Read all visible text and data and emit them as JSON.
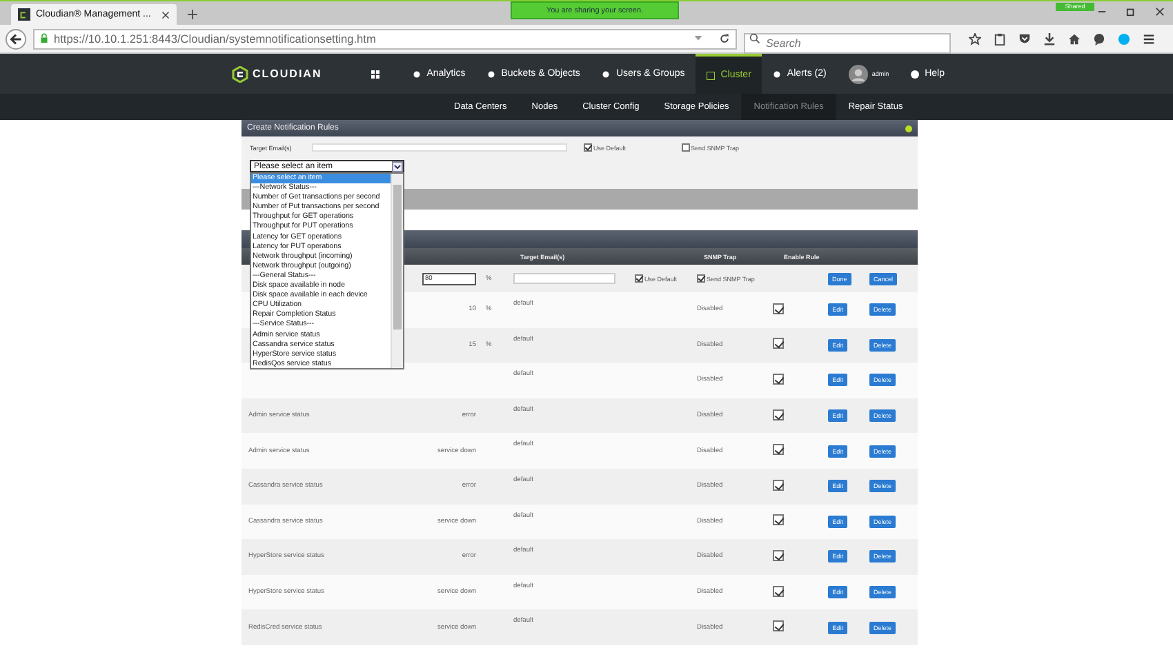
{
  "browser": {
    "tab_title": "Cloudian® Management ...",
    "url": "https://10.10.1.251:8443/Cloudian/systemnotificationsetting.htm",
    "search_placeholder": "Search",
    "sharing_banner": "You are sharing your screen.",
    "shared_badge": "Shared"
  },
  "nav": {
    "logo": "CLOUDIAN",
    "items": [
      {
        "label": "Analytics",
        "selected": false
      },
      {
        "label": "Buckets & Objects",
        "selected": false
      },
      {
        "label": "Users & Groups",
        "selected": false
      },
      {
        "label": "Cluster",
        "selected": true
      },
      {
        "label": "Alerts (2)",
        "selected": false
      }
    ],
    "user": "admin",
    "help": "Help"
  },
  "subnav": [
    {
      "label": "Data Centers",
      "selected": false
    },
    {
      "label": "Nodes",
      "selected": false
    },
    {
      "label": "Cluster Config",
      "selected": false
    },
    {
      "label": "Storage Policies",
      "selected": false
    },
    {
      "label": "Notification Rules",
      "selected": true
    },
    {
      "label": "Repair Status",
      "selected": false
    }
  ],
  "create_panel": {
    "title": "Create Notification Rules",
    "target_label": "Target Email(s)",
    "use_default": {
      "label": "Use Default",
      "checked": true
    },
    "send_snmp": {
      "label": "Send SNMP Trap",
      "checked": false
    },
    "select_value": "Please select an item",
    "options": [
      {
        "label": "Please select an item",
        "selected": true
      },
      {
        "label": "---Network Status---",
        "selected": false
      },
      {
        "label": "Number of Get transactions per second",
        "selected": false
      },
      {
        "label": "Number of Put transactions per second",
        "selected": false
      },
      {
        "label": "Throughput for GET operations",
        "selected": false
      },
      {
        "label": "Throughput for PUT operations",
        "selected": false
      },
      {
        "label": "Latency for GET operations",
        "selected": false
      },
      {
        "label": "Latency for PUT operations",
        "selected": false
      },
      {
        "label": "Network throughput (incoming)",
        "selected": false
      },
      {
        "label": "Network throughput (outgoing)",
        "selected": false
      },
      {
        "label": "---General Status---",
        "selected": false
      },
      {
        "label": "Disk space available in node",
        "selected": false
      },
      {
        "label": "Disk space available in each device",
        "selected": false
      },
      {
        "label": "CPU Utilization",
        "selected": false
      },
      {
        "label": "Repair Completion Status",
        "selected": false
      },
      {
        "label": "---Service Status---",
        "selected": false
      },
      {
        "label": "Admin service status",
        "selected": false
      },
      {
        "label": "Cassandra service status",
        "selected": false
      },
      {
        "label": "HyperStore service status",
        "selected": false
      },
      {
        "label": "RedisQos service status",
        "selected": false
      }
    ]
  },
  "rules_table": {
    "columns": [
      "Target Email(s)",
      "SNMP Trap",
      "Enable Rule"
    ],
    "rows": [
      {
        "kind": "edit",
        "value": "80",
        "unit": "%",
        "use_default": {
          "label": "Use Default",
          "checked": true
        },
        "send_snmp": {
          "label": "Send SNMP Trap",
          "checked": true
        },
        "buttons": [
          "Done",
          "Cancel"
        ]
      },
      {
        "kind": "view",
        "value": "10",
        "unit": "%",
        "email": "default",
        "snmp": "Disabled",
        "enabled": true,
        "buttons": [
          "Edit",
          "Delete"
        ]
      },
      {
        "kind": "view",
        "value": "15",
        "unit": "%",
        "email": "default",
        "snmp": "Disabled",
        "enabled": true,
        "buttons": [
          "Edit",
          "Delete"
        ]
      },
      {
        "kind": "view",
        "email": "default",
        "snmp": "Disabled",
        "enabled": true,
        "buttons": [
          "Edit",
          "Delete"
        ]
      },
      {
        "kind": "view",
        "name": "Admin service status",
        "value": "error",
        "email": "default",
        "snmp": "Disabled",
        "enabled": true,
        "buttons": [
          "Edit",
          "Delete"
        ]
      },
      {
        "kind": "view",
        "name": "Admin service status",
        "value": "service down",
        "email": "default",
        "snmp": "Disabled",
        "enabled": true,
        "buttons": [
          "Edit",
          "Delete"
        ]
      },
      {
        "kind": "view",
        "name": "Cassandra service status",
        "value": "error",
        "email": "default",
        "snmp": "Disabled",
        "enabled": true,
        "buttons": [
          "Edit",
          "Delete"
        ]
      },
      {
        "kind": "view",
        "name": "Cassandra service status",
        "value": "service down",
        "email": "default",
        "snmp": "Disabled",
        "enabled": true,
        "buttons": [
          "Edit",
          "Delete"
        ]
      },
      {
        "kind": "view",
        "name": "HyperStore service status",
        "value": "error",
        "email": "default",
        "snmp": "Disabled",
        "enabled": true,
        "buttons": [
          "Edit",
          "Delete"
        ]
      },
      {
        "kind": "view",
        "name": "HyperStore service status",
        "value": "service down",
        "email": "default",
        "snmp": "Disabled",
        "enabled": true,
        "buttons": [
          "Edit",
          "Delete"
        ]
      },
      {
        "kind": "view",
        "name": "RedisCred service status",
        "value": "service down",
        "email": "default",
        "snmp": "Disabled",
        "enabled": true,
        "buttons": [
          "Edit",
          "Delete"
        ]
      }
    ]
  }
}
